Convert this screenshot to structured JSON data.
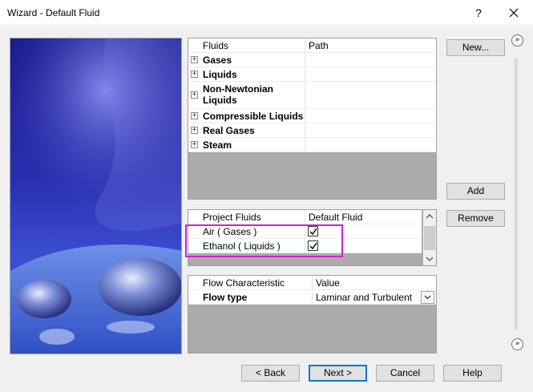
{
  "window": {
    "title": "Wizard - Default Fluid",
    "help_glyph": "?",
    "close_icon": "close-icon"
  },
  "fluids_grid": {
    "col_fluids": "Fluids",
    "col_path": "Path",
    "rows": [
      {
        "label": "Gases",
        "path": ""
      },
      {
        "label": "Liquids",
        "path": ""
      },
      {
        "label": "Non-Newtonian",
        "label2": "Liquids",
        "path": ""
      },
      {
        "label": "Compressible Liquids",
        "path": ""
      },
      {
        "label": "Real Gases",
        "path": ""
      },
      {
        "label": "Steam",
        "path": ""
      }
    ],
    "expand_glyph": "+"
  },
  "project_grid": {
    "col_project": "Project Fluids",
    "col_default": "Default Fluid",
    "rows": [
      {
        "label": "Air ( Gases )",
        "default": true
      },
      {
        "label": "Ethanol ( Liquids )",
        "default": true
      }
    ]
  },
  "flow_grid": {
    "col_characteristic": "Flow Characteristic",
    "col_value": "Value",
    "row_label": "Flow type",
    "row_value": "Laminar and Turbulent"
  },
  "side_buttons": {
    "new": "New...",
    "add": "Add",
    "remove": "Remove"
  },
  "footer_buttons": {
    "back": "< Back",
    "next": "Next >",
    "cancel": "Cancel",
    "help": "Help"
  },
  "rail_glyph": "»",
  "colors": {
    "highlight": "#d421d4",
    "grid_empty": "#ababab",
    "focus_border": "#0078d7"
  }
}
